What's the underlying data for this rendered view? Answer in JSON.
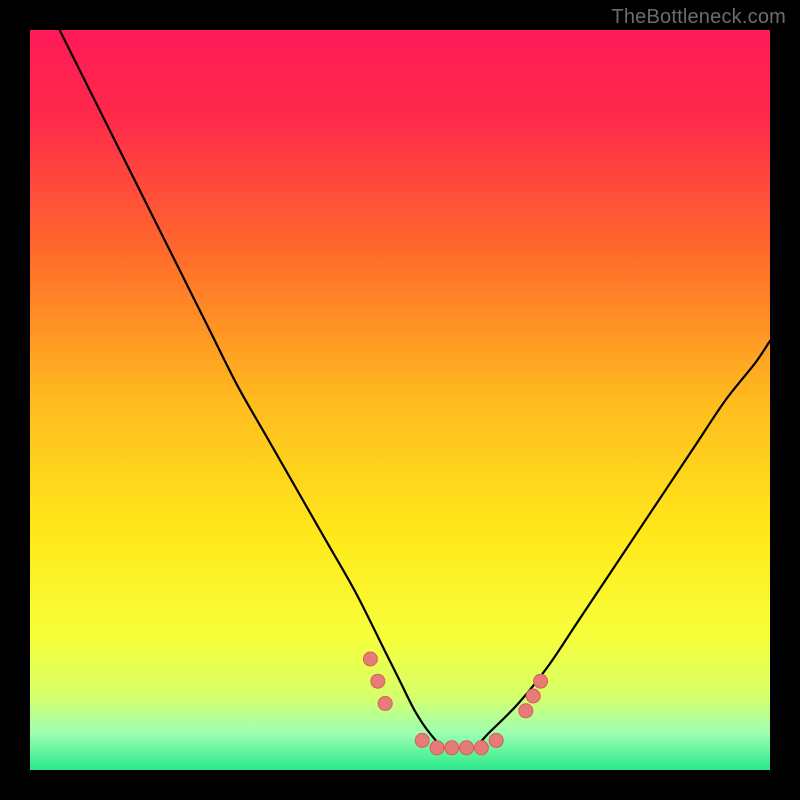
{
  "watermark": "TheBottleneck.com",
  "colors": {
    "frame": "#000000",
    "gradient_stops": [
      {
        "offset": 0.0,
        "color": "#ff1a58"
      },
      {
        "offset": 0.12,
        "color": "#ff2a4a"
      },
      {
        "offset": 0.3,
        "color": "#ff6a2b"
      },
      {
        "offset": 0.5,
        "color": "#ffbb1f"
      },
      {
        "offset": 0.68,
        "color": "#ffe81a"
      },
      {
        "offset": 0.82,
        "color": "#f7ff3a"
      },
      {
        "offset": 0.9,
        "color": "#d6ff6a"
      },
      {
        "offset": 0.95,
        "color": "#9dffb2"
      },
      {
        "offset": 1.0,
        "color": "#29e98a"
      }
    ],
    "curve": "#000000",
    "marker_fill": "#e77b77",
    "marker_stroke": "#d45f58"
  },
  "chart_data": {
    "type": "line",
    "title": "",
    "xlabel": "",
    "ylabel": "",
    "xlim": [
      0,
      100
    ],
    "ylim": [
      0,
      100
    ],
    "series": [
      {
        "name": "bottleneck-curve",
        "x": [
          4,
          8,
          12,
          16,
          20,
          24,
          28,
          32,
          36,
          40,
          44,
          48,
          50,
          52,
          54,
          56,
          58,
          60,
          62,
          66,
          70,
          74,
          78,
          82,
          86,
          90,
          94,
          98,
          100
        ],
        "y": [
          100,
          92,
          84,
          76,
          68,
          60,
          52,
          45,
          38,
          31,
          24,
          16,
          12,
          8,
          5,
          3,
          3,
          3,
          5,
          9,
          14,
          20,
          26,
          32,
          38,
          44,
          50,
          55,
          58
        ]
      }
    ],
    "markers": {
      "name": "highlight-markers",
      "points": [
        {
          "x": 46,
          "y": 15
        },
        {
          "x": 47,
          "y": 12
        },
        {
          "x": 48,
          "y": 9
        },
        {
          "x": 53,
          "y": 4
        },
        {
          "x": 55,
          "y": 3
        },
        {
          "x": 57,
          "y": 3
        },
        {
          "x": 59,
          "y": 3
        },
        {
          "x": 61,
          "y": 3
        },
        {
          "x": 63,
          "y": 4
        },
        {
          "x": 67,
          "y": 8
        },
        {
          "x": 68,
          "y": 10
        },
        {
          "x": 69,
          "y": 12
        }
      ]
    }
  }
}
